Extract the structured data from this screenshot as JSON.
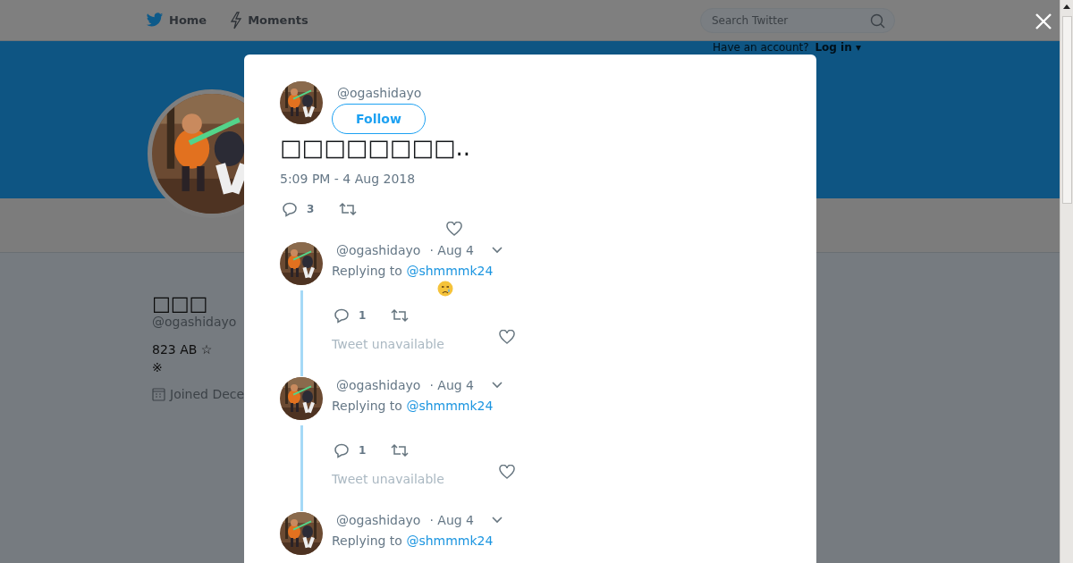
{
  "header": {
    "nav": [
      {
        "label": "Home"
      },
      {
        "label": "Moments"
      }
    ],
    "search": {
      "placeholder": "Search Twitter"
    },
    "account_prompt": "Have an account?",
    "login": "Log in ▾"
  },
  "profile": {
    "name": "□□□",
    "handle": "@ogashidayo",
    "bio": [
      "823 AB ☆",
      "※"
    ],
    "joined": "Joined Dece"
  },
  "modal": {
    "tweet": {
      "handle": "@ogashidayo",
      "follow": "Follow",
      "text": "□□□□□□□□..",
      "time": "5:09 PM - 4 Aug 2018",
      "reply_count": "3"
    },
    "replies": [
      {
        "handle": "@ogashidayo",
        "date": "· Aug 4",
        "replying_label": "Replying to",
        "replying_to": "@shmmmk24",
        "emoji": true,
        "reply_count": "1",
        "quoted": "Tweet unavailable"
      },
      {
        "handle": "@ogashidayo",
        "date": "· Aug 4",
        "replying_label": "Replying to",
        "replying_to": "@shmmmk24",
        "reply_count": "1",
        "quoted": "Tweet unavailable"
      },
      {
        "handle": "@ogashidayo",
        "date": "· Aug 4",
        "replying_label": "Replying to",
        "replying_to": "@shmmmk24"
      }
    ]
  }
}
